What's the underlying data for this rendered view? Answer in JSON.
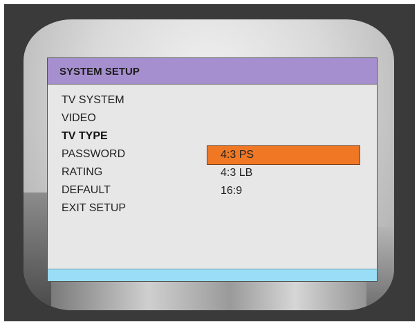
{
  "menu": {
    "title": "SYSTEM SETUP",
    "items": [
      {
        "label": "TV SYSTEM",
        "active": false
      },
      {
        "label": "VIDEO",
        "active": false
      },
      {
        "label": "TV TYPE",
        "active": true
      },
      {
        "label": "PASSWORD",
        "active": false
      },
      {
        "label": "RATING",
        "active": false
      },
      {
        "label": "DEFAULT",
        "active": false
      },
      {
        "label": "EXIT SETUP",
        "active": false
      }
    ]
  },
  "tv_type_options": {
    "items": [
      {
        "label": "4:3 PS",
        "selected": true
      },
      {
        "label": "4:3 LB",
        "selected": false
      },
      {
        "label": "16:9",
        "selected": false
      }
    ]
  },
  "colors": {
    "title_bar": "#a68fcf",
    "highlight": "#f07824",
    "footer_bar": "#99def6",
    "menu_bg": "#e7e7e7"
  }
}
